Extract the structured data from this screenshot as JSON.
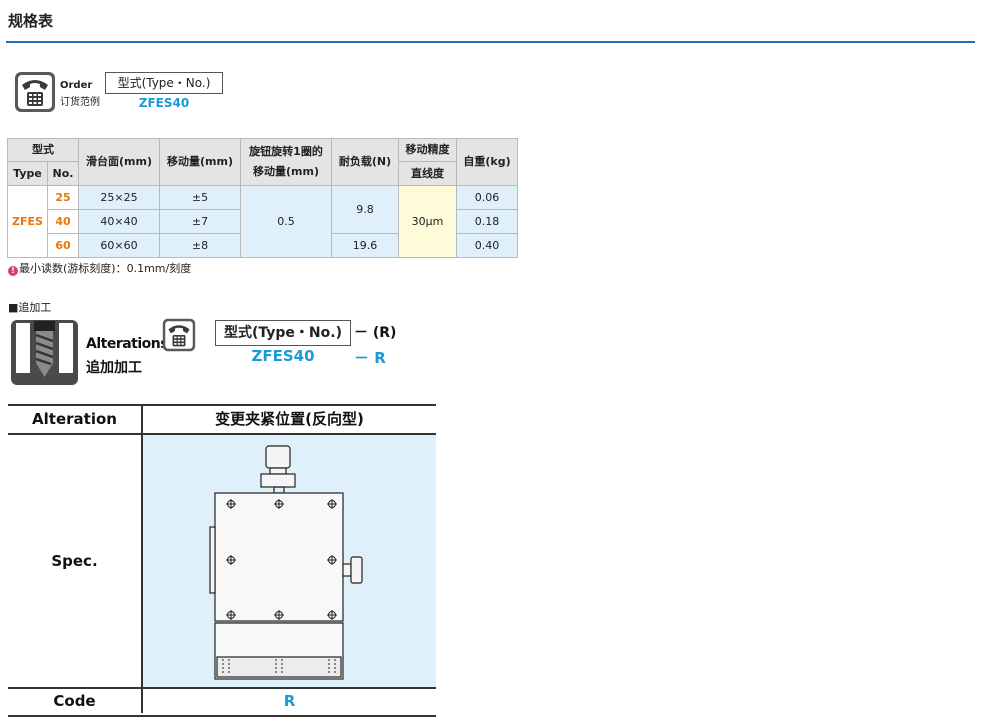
{
  "page": {
    "title": "规格表"
  },
  "order": {
    "label_en": "Order",
    "label_cn": "订货范例",
    "type_box": "型式(Type・No.)",
    "code": "ZFES40"
  },
  "spec_table": {
    "headers": {
      "type_group": "型式",
      "type": "Type",
      "no": "No.",
      "slide_face": "滑台面(mm)",
      "travel": "移动量(mm)",
      "knob_travel_l1": "旋钮旋转1圈的",
      "knob_travel_l2": "移动量(mm)",
      "load": "耐负载(N)",
      "accuracy": "移动精度",
      "straightness": "直线度",
      "weight": "自重(kg)"
    },
    "type_value": "ZFES",
    "rows": [
      {
        "no": "25",
        "slide_face": "25×25",
        "travel": "±5",
        "weight": "0.06"
      },
      {
        "no": "40",
        "slide_face": "40×40",
        "travel": "±7",
        "weight": "0.18"
      },
      {
        "no": "60",
        "slide_face": "60×60",
        "travel": "±8",
        "weight": "0.40"
      }
    ],
    "knob_travel_value": "0.5",
    "load_values": [
      "9.8",
      "19.6"
    ],
    "straightness_value": "30μm"
  },
  "note": {
    "icon": "pin-icon",
    "text": "最小读数(游标刻度)：0.1mm/刻度"
  },
  "alterations": {
    "heading": "■追加工",
    "label_en": "Alterations",
    "label_cn": "追加加工",
    "type_box": "型式(Type・No.)",
    "suffix": "－ (R)",
    "code": "ZFES40",
    "code_suffix": "－  R",
    "table": {
      "header_left": "Alteration",
      "header_right": "变更夹紧位置(反向型)",
      "spec_label": "Spec.",
      "code_label": "Code",
      "code_value": "R"
    }
  },
  "colors": {
    "accent_blue": "#1a9ad6",
    "rule_blue": "#1e6fb8",
    "orange": "#e4780f",
    "cell_blue": "#dff0fb",
    "cell_yellow": "#fdfbd8"
  }
}
